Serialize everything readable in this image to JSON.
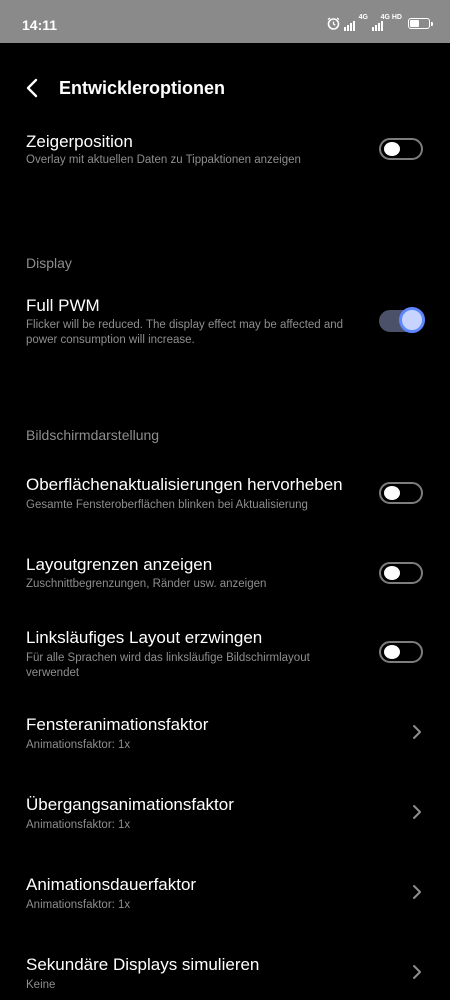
{
  "status_bar": {
    "time": "14:11",
    "network1": "4G",
    "network2": "4G HD",
    "icons": [
      "alarm-icon",
      "signal-icon",
      "signal-icon",
      "battery-icon"
    ]
  },
  "header": {
    "title": "Entwickleroptionen"
  },
  "rows": {
    "zeigerposition": {
      "title": "Zeigerposition",
      "subtitle": "Overlay mit aktuellen Daten zu Tippaktionen anzeigen",
      "on": false
    },
    "full_pwm": {
      "title": "Full PWM",
      "subtitle": "Flicker will be reduced. The display effect may be affected and power consumption will increase.",
      "on": true
    },
    "oberflaechen": {
      "title": "Oberflächenaktualisierungen hervorheben",
      "subtitle": "Gesamte Fensteroberflächen blinken bei Aktualisierung",
      "on": false
    },
    "layoutgrenzen": {
      "title": "Layoutgrenzen anzeigen",
      "subtitle": "Zuschnittbegrenzungen, Ränder usw. anzeigen",
      "on": false
    },
    "linkslaeufig": {
      "title": "Linksläufiges Layout erzwingen",
      "subtitle": "Für alle Sprachen wird das linksläufige Bildschirmlayout verwendet",
      "on": false
    },
    "fenster": {
      "title": "Fensteranimationsfaktor",
      "subtitle": "Animationsfaktor: 1x"
    },
    "uebergang": {
      "title": "Übergangsanimationsfaktor",
      "subtitle": "Animationsfaktor: 1x"
    },
    "dauer": {
      "title": "Animationsdauerfaktor",
      "subtitle": "Animationsfaktor: 1x"
    },
    "sekundaer": {
      "title": "Sekundäre Displays simulieren",
      "subtitle": "Keine"
    }
  },
  "sections": {
    "display": "Display",
    "bildschirm": "Bildschirmdarstellung"
  },
  "colors": {
    "background": "#000000",
    "status_bar": "#8a8a8a",
    "accent": "#5e86ff",
    "secondary_text": "#8e8e8e"
  }
}
